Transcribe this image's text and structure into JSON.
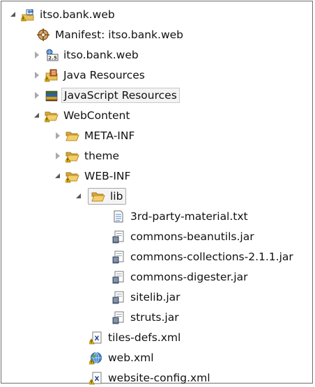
{
  "tree": {
    "project": "itso.bank.web",
    "manifest": "Manifest: itso.bank.web",
    "deployment": "itso.bank.web",
    "java_resources": "Java Resources",
    "javascript_resources": "JavaScript Resources",
    "webcontent": "WebContent",
    "meta_inf": "META-INF",
    "theme": "theme",
    "web_inf": "WEB-INF",
    "lib": "lib",
    "lib_files": [
      "3rd-party-material.txt",
      "commons-beanutils.jar",
      "commons-collections-2.1.1.jar",
      "commons-digester.jar",
      "sitelib.jar",
      "struts.jar"
    ],
    "tiles_defs": "tiles-defs.xml",
    "web_xml": "web.xml",
    "website_config": "website-config.xml"
  },
  "colors": {
    "folder": "#e8c15a",
    "folder_dark": "#b8892a",
    "expand_arrow": "#595959",
    "collapse_arrow": "#a9a9a9",
    "warning": "#f0c000",
    "selection_border": "#c9c9c9"
  },
  "icons": {
    "project": "web-project-icon",
    "manifest": "manifest-icon",
    "deployment": "deployment-descriptor-icon",
    "java_resources": "java-resources-icon",
    "javascript_resources": "javascript-resources-icon",
    "folder": "folder-icon",
    "text_file": "text-file-icon",
    "jar": "jar-file-icon",
    "xml": "xml-file-icon",
    "web_xml": "web-xml-icon"
  }
}
